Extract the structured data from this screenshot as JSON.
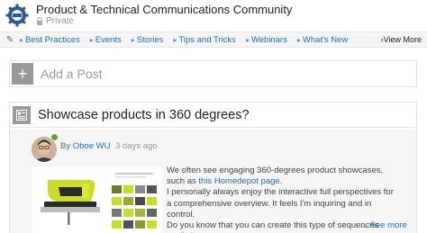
{
  "community": {
    "title": "Product & Technical Communications Community",
    "privacy": "Private",
    "logo_icon": "community-gear-logo"
  },
  "nav": {
    "items": [
      {
        "label": "Best Practices",
        "icon": "tag-icon"
      },
      {
        "label": "Events",
        "icon": "tag-icon"
      },
      {
        "label": "Stories",
        "icon": "tag-icon"
      },
      {
        "label": "Tips and Tricks",
        "icon": "tag-icon"
      },
      {
        "label": "Webinars",
        "icon": "tag-icon"
      },
      {
        "label": "What's New",
        "icon": "tag-icon"
      }
    ],
    "view_more": "View More"
  },
  "add_post": {
    "label": "Add a Post",
    "icon": "plus-icon"
  },
  "post": {
    "title": "Showcase products in 360 degrees?",
    "by_prefix": "By",
    "author": "Oboe WU",
    "time": "3 days ago",
    "body_lead": "We often see engaging 360-degrees product showcases, such as ",
    "body_link": "this Homedepot page",
    "body_link_suffix": ".",
    "body_p2": "I personally always enjoy the interactive full perspectives for a comprehensive overview. It feels I'm inquiring and in control.",
    "body_p3": "Do you know that you can create this type of sequences easily in",
    "see_more": "... See more"
  },
  "colors": {
    "link": "#1f6fb2",
    "icon_gray": "#999999",
    "badge_green": "#5aa632"
  }
}
